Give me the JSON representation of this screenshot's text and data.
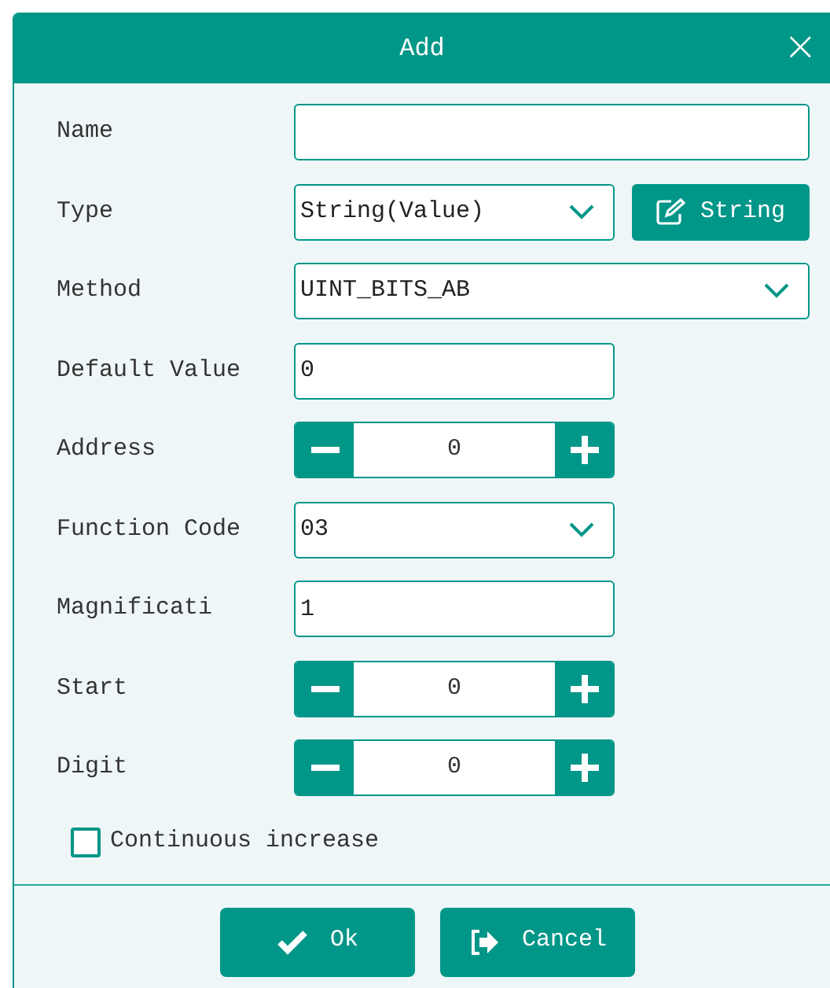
{
  "dialog": {
    "title": "Add",
    "close": "×"
  },
  "fields": [
    {
      "kind": "text_wide",
      "label": "Name"
    },
    {
      "kind": "select_button",
      "label": "Type",
      "value": "String(Value)",
      "button": "String"
    },
    {
      "kind": "select_wide",
      "label": "Method",
      "value": "UINT_BITS_AB"
    },
    {
      "kind": "text",
      "label": "Default Value",
      "value": "0"
    },
    {
      "kind": "stepper",
      "label": "Address",
      "value": "0"
    },
    {
      "kind": "select",
      "label": "Function Code",
      "value": "03"
    },
    {
      "kind": "text",
      "label": "Magnificati",
      "value": "1"
    },
    {
      "kind": "stepper",
      "label": "Start",
      "value": "0"
    },
    {
      "kind": "stepper",
      "label": "Digit",
      "value": "0"
    }
  ],
  "checkbox": {
    "label": "Continuous increase",
    "checked": false
  },
  "buttons": [
    {
      "kind": "ok",
      "label": "Ok"
    },
    {
      "kind": "cancel",
      "label": "Cancel"
    }
  ]
}
